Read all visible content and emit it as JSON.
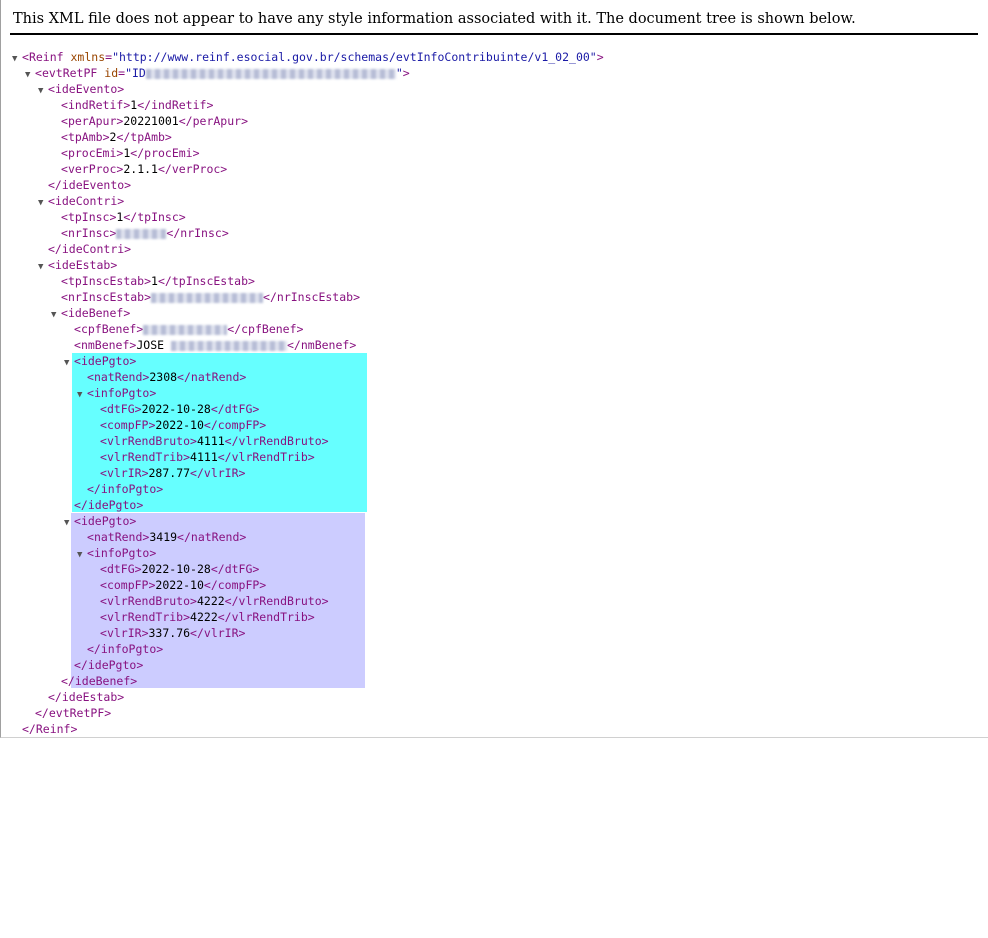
{
  "header_text": "This XML file does not appear to have any style information associated with it. The document tree is shown below.",
  "colors": {
    "tag": "#881280",
    "highlight_1": "#66ffff",
    "highlight_2": "#ccccff"
  },
  "tree": {
    "reinf_open": "Reinf",
    "reinf_attr_name": "xmlns",
    "reinf_attr_value": "\"http://www.reinf.esocial.gov.br/schemas/evtInfoContribuinte/v1_02_00\"",
    "evt_open": "evtRetPF",
    "evt_attr_name": "id",
    "evt_attr_value_prefix": "\"ID",
    "evt_attr_value_suffix": "\"",
    "ideEvento": "ideEvento",
    "indRetif": {
      "name": "indRetif",
      "value": "1"
    },
    "perApur": {
      "name": "perApur",
      "value": "20221001"
    },
    "tpAmb": {
      "name": "tpAmb",
      "value": "2"
    },
    "procEmi": {
      "name": "procEmi",
      "value": "1"
    },
    "verProc": {
      "name": "verProc",
      "value": "2.1.1"
    },
    "ideContri": "ideContri",
    "tpInsc": {
      "name": "tpInsc",
      "value": "1"
    },
    "nrInsc": {
      "name": "nrInsc"
    },
    "ideEstab": "ideEstab",
    "tpInscEstab": {
      "name": "tpInscEstab",
      "value": "1"
    },
    "nrInscEstab": {
      "name": "nrInscEstab"
    },
    "ideBenef": "ideBenef",
    "cpfBenef": {
      "name": "cpfBenef"
    },
    "nmBenef": {
      "name": "nmBenef",
      "value": "JOSE"
    },
    "pgto1": {
      "tag": "idePgto",
      "natRend": {
        "name": "natRend",
        "value": "2308"
      },
      "info": "infoPgto",
      "dtFG": {
        "name": "dtFG",
        "value": "2022-10-28"
      },
      "compFP": {
        "name": "compFP",
        "value": "2022-10"
      },
      "vlrRendBruto": {
        "name": "vlrRendBruto",
        "value": "4111"
      },
      "vlrRendTrib": {
        "name": "vlrRendTrib",
        "value": "4111"
      },
      "vlrIR": {
        "name": "vlrIR",
        "value": "287.77"
      }
    },
    "pgto2": {
      "tag": "idePgto",
      "natRend": {
        "name": "natRend",
        "value": "3419"
      },
      "info": "infoPgto",
      "dtFG": {
        "name": "dtFG",
        "value": "2022-10-28"
      },
      "compFP": {
        "name": "compFP",
        "value": "2022-10"
      },
      "vlrRendBruto": {
        "name": "vlrRendBruto",
        "value": "4222"
      },
      "vlrRendTrib": {
        "name": "vlrRendTrib",
        "value": "4222"
      },
      "vlrIR": {
        "name": "vlrIR",
        "value": "337.76"
      }
    }
  }
}
